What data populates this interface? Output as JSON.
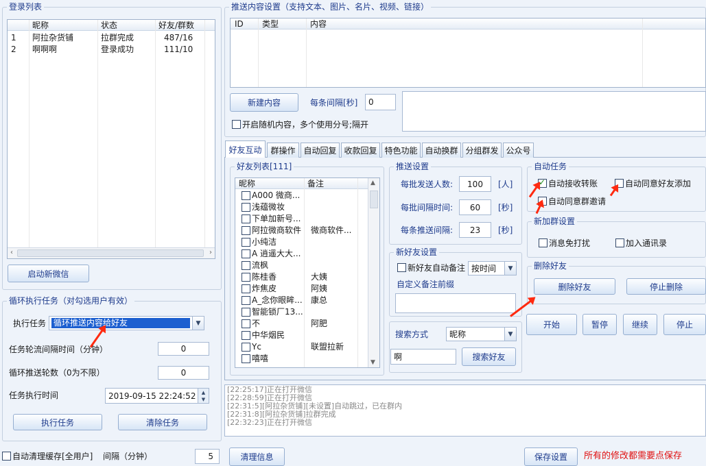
{
  "login": {
    "title": "登录列表",
    "columns": [
      "昵称",
      "状态",
      "好友/群数"
    ],
    "rows": [
      {
        "idx": "1",
        "name": "阿拉杂货铺",
        "status": "拉群完成",
        "count": "487/16"
      },
      {
        "idx": "2",
        "name": "啊啊啊",
        "status": "登录成功",
        "count": "111/10"
      }
    ],
    "start_btn": "启动新微信"
  },
  "loop": {
    "title": "循环执行任务（对勾选用户有效）",
    "task_label": "执行任务",
    "task_value": "循环推送内容给好友",
    "interval_label": "任务轮流间隔时间（分钟）",
    "interval_value": "0",
    "rounds_label": "循环推送轮数（0为不限）",
    "rounds_value": "0",
    "time_label": "任务执行时间",
    "time_value": "2019-09-15 22:24:52",
    "exec_btn": "执行任务",
    "clear_btn": "清除任务"
  },
  "auto_clean": {
    "label": "自动清理缓存[全用户]",
    "interval_label": "间隔（分钟）",
    "interval_value": "5"
  },
  "push_content": {
    "title": "推送内容设置（支持文本、图片、名片、视频、链接）",
    "columns": [
      "ID",
      "类型",
      "内容"
    ],
    "new_btn": "新建内容",
    "interval_label": "每条间隔[秒]",
    "interval_value": "0",
    "random_label": "开启随机内容，多个使用分号;隔开"
  },
  "tabs": [
    "好友互动",
    "群操作",
    "自动回复",
    "收款回复",
    "特色功能",
    "自动换群",
    "分组群发",
    "公众号"
  ],
  "friends": {
    "title": "好友列表[111]",
    "columns": [
      "昵称",
      "备注"
    ],
    "rows": [
      {
        "name": "A000  微商...",
        "remark": ""
      },
      {
        "name": "浅蕴微妆",
        "remark": ""
      },
      {
        "name": "下单加新号...",
        "remark": ""
      },
      {
        "name": "阿拉微商软件",
        "remark": "微商软件..."
      },
      {
        "name": "小纯洁",
        "remark": ""
      },
      {
        "name": "A 逍遥大大...",
        "remark": ""
      },
      {
        "name": "流枫",
        "remark": ""
      },
      {
        "name": "陈桂香",
        "remark": "大姨"
      },
      {
        "name": "炸焦皮",
        "remark": "阿姨"
      },
      {
        "name": "A_念你眼眸...",
        "remark": "康总"
      },
      {
        "name": "智能锁厂13...",
        "remark": ""
      },
      {
        "name": "不",
        "remark": "阿肥"
      },
      {
        "name": "中华烟民",
        "remark": ""
      },
      {
        "name": "Yc",
        "remark": "联盟拉新"
      },
      {
        "name": "嘻嘻",
        "remark": ""
      }
    ]
  },
  "push_settings": {
    "title": "推送设置",
    "per_batch_label": "每批发送人数:",
    "per_batch_value": "100",
    "per_batch_unit": "[人]",
    "batch_interval_label": "每批间隔时间:",
    "batch_interval_value": "60",
    "batch_interval_unit": "[秒]",
    "item_interval_label": "每条推送间隔:",
    "item_interval_value": "23",
    "item_interval_unit": "[秒]"
  },
  "new_friend": {
    "title": "新好友设置",
    "auto_remark_label": "新好友自动备注",
    "remark_mode": "按时间",
    "prefix_label": "自定义备注前缀"
  },
  "search": {
    "label": "搜索方式",
    "mode": "昵称",
    "query": "啊",
    "btn": "搜索好友"
  },
  "auto_task": {
    "title": "自动任务",
    "accept_transfer": "自动接收转账",
    "accept_friend": "自动同意好友添加",
    "accept_group": "自动同意群邀请"
  },
  "new_group": {
    "title": "新加群设置",
    "mute": "消息免打扰",
    "add_contacts": "加入通讯录"
  },
  "delete_friend": {
    "title": "删除好友",
    "delete_btn": "删除好友",
    "stop_btn": "停止删除"
  },
  "controls": {
    "start": "开始",
    "pause": "暂停",
    "resume": "继续",
    "stop": "停止"
  },
  "logs": [
    "[22:25:17]正在打开微信",
    "[22:28:59]正在打开微信",
    "[22:31:5][阿拉杂货铺][未设置]自动跳过，已在群内",
    "[22:31:8][阿拉杂货铺]拉群完成",
    "[22:32:23]正在打开微信"
  ],
  "footer": {
    "clear_btn": "清理信息",
    "save_btn": "保存设置",
    "note": "所有的修改都需要点保存"
  },
  "colors": {
    "label": "#1e3b8c",
    "note": "#e01010",
    "arrow": "#ff2a10",
    "selection": "#1c5fd0"
  }
}
